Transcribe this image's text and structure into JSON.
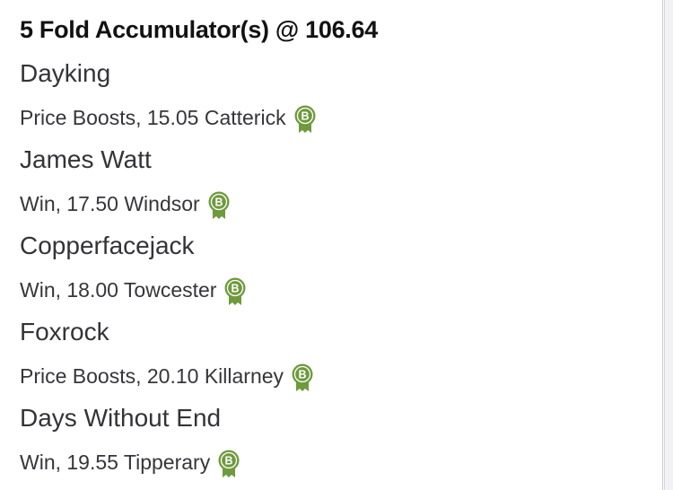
{
  "bet": {
    "title": "5 Fold Accumulator(s) @ 106.64"
  },
  "selections": [
    {
      "horse": "Dayking",
      "detail": "Price Boosts, 15.05 Catterick",
      "badge_letter": "B"
    },
    {
      "horse": "James Watt",
      "detail": "Win, 17.50 Windsor",
      "badge_letter": "B"
    },
    {
      "horse": "Copperfacejack",
      "detail": "Win, 18.00 Towcester",
      "badge_letter": "B"
    },
    {
      "horse": "Foxrock",
      "detail": "Price Boosts, 20.10 Killarney",
      "badge_letter": "B"
    },
    {
      "horse": "Days Without End",
      "detail": "Win, 19.55 Tipperary",
      "badge_letter": "B"
    }
  ],
  "icons": {
    "badge": "best-odds-guaranteed-rosette-icon"
  },
  "colors": {
    "badge_green": "#6f9a3d",
    "title_text": "#121214",
    "body_text": "#333438"
  }
}
